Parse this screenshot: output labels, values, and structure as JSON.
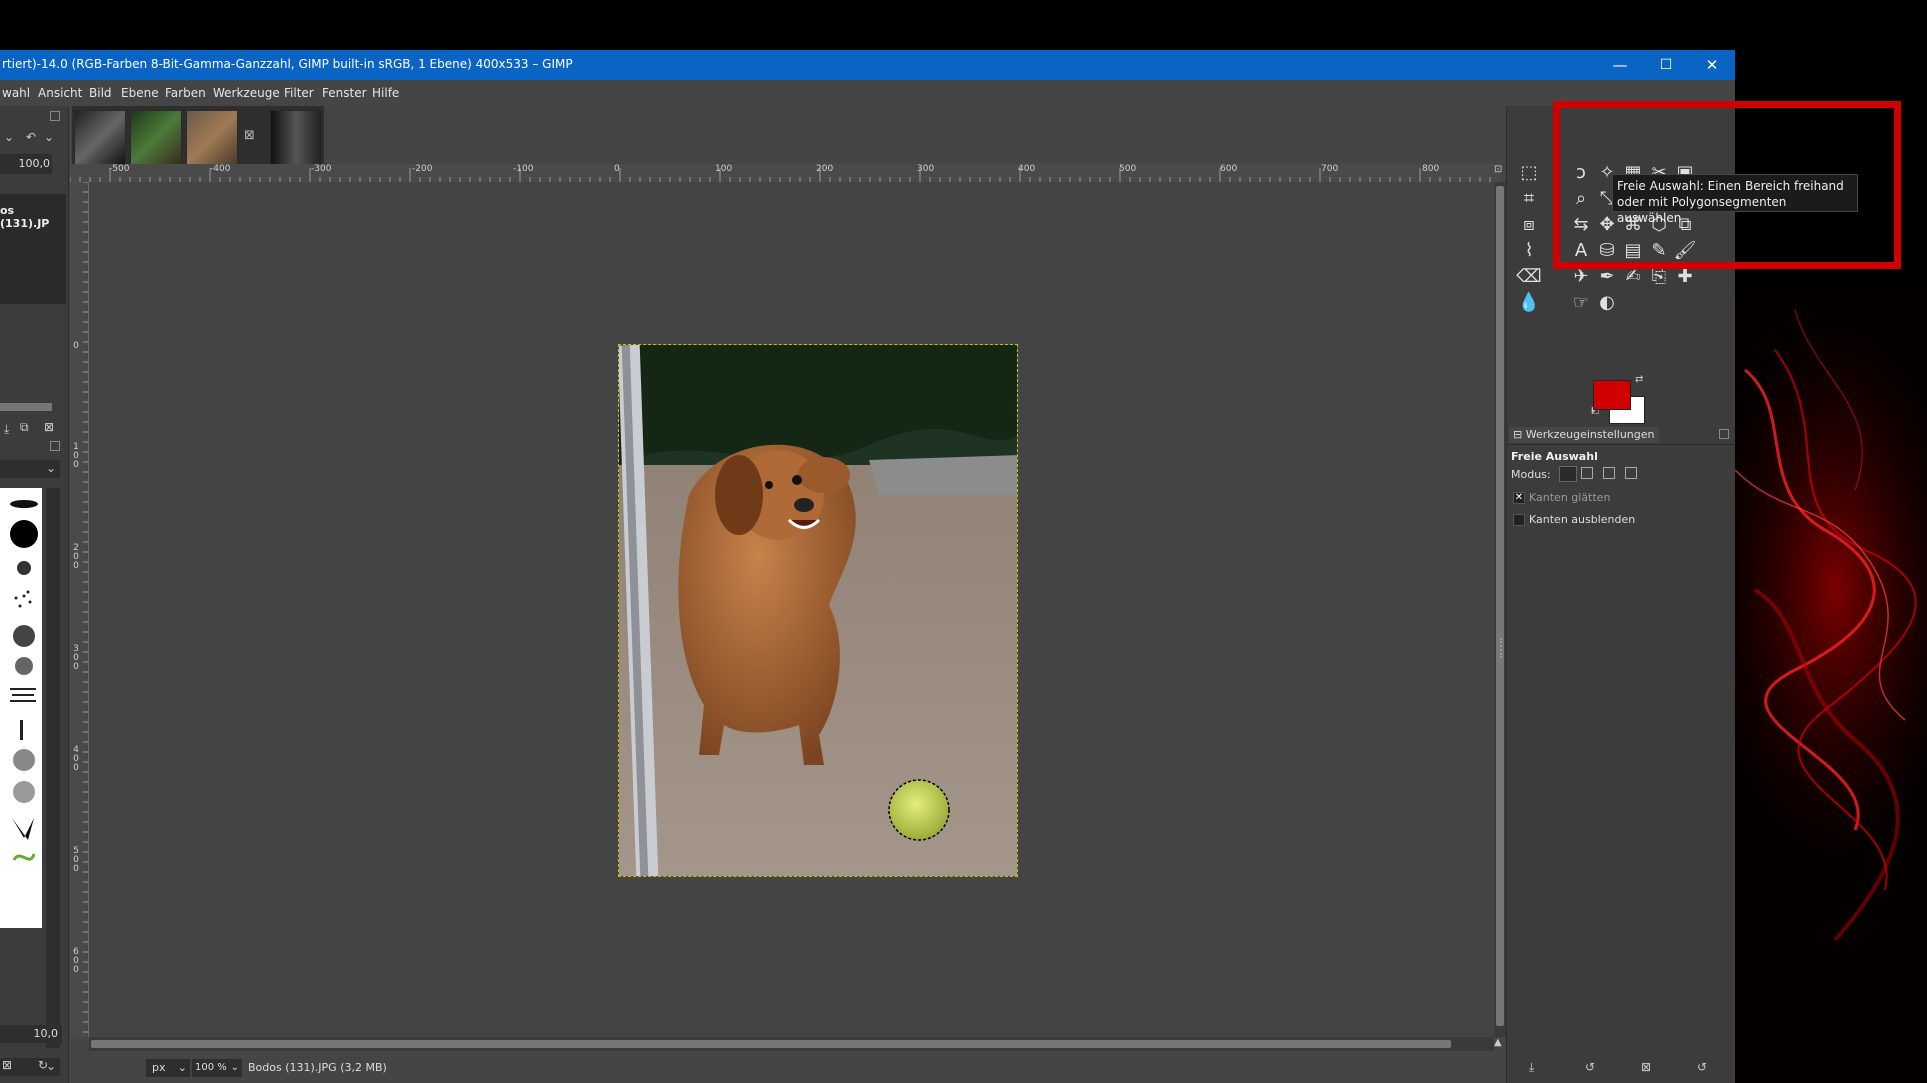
{
  "window": {
    "title": "rtiert)-14.0 (RGB-Farben 8-Bit-Gamma-Ganzzahl, GIMP built-in sRGB, 1 Ebene) 400x533 – GIMP",
    "controls": {
      "minimize": "—",
      "maximize": "☐",
      "close": "✕"
    }
  },
  "menu": [
    "wahl",
    "Ansicht",
    "Bild",
    "Ebene",
    "Farben",
    "Werkzeuge",
    "Filter",
    "Fenster",
    "Hilfe"
  ],
  "left_dock": {
    "layer_value": "100,0",
    "image_label": "os (131).JP",
    "brush_size": "10,0"
  },
  "rulers": {
    "horizontal": [
      "-500",
      "-400",
      "-300",
      "-200",
      "-100",
      "0",
      "100",
      "200",
      "300",
      "400",
      "500",
      "600",
      "700",
      "800"
    ],
    "vertical": [
      "0",
      "1\n0\n0",
      "2\n0\n0",
      "3\n0\n0",
      "4\n0\n0",
      "5\n0\n0",
      "6\n0\n0"
    ]
  },
  "status": {
    "unit": "px",
    "zoom": "100 %",
    "file": "Bodos (131).JPG (3,2 MB)"
  },
  "toolbox": {
    "tooltip_line1": "Freie Auswahl: Einen Bereich freihand",
    "tooltip_line2": "oder mit Polygonsegmenten auswählen",
    "fg_color": "#d10000",
    "bg_color": "#ffffff"
  },
  "tool_options": {
    "tab_label": "Werkzeugeinstellungen",
    "tool_name": "Freie Auswahl",
    "mode_label": "Modus:",
    "antialias_label": "Kanten glätten",
    "feather_label": "Kanten ausblenden"
  }
}
